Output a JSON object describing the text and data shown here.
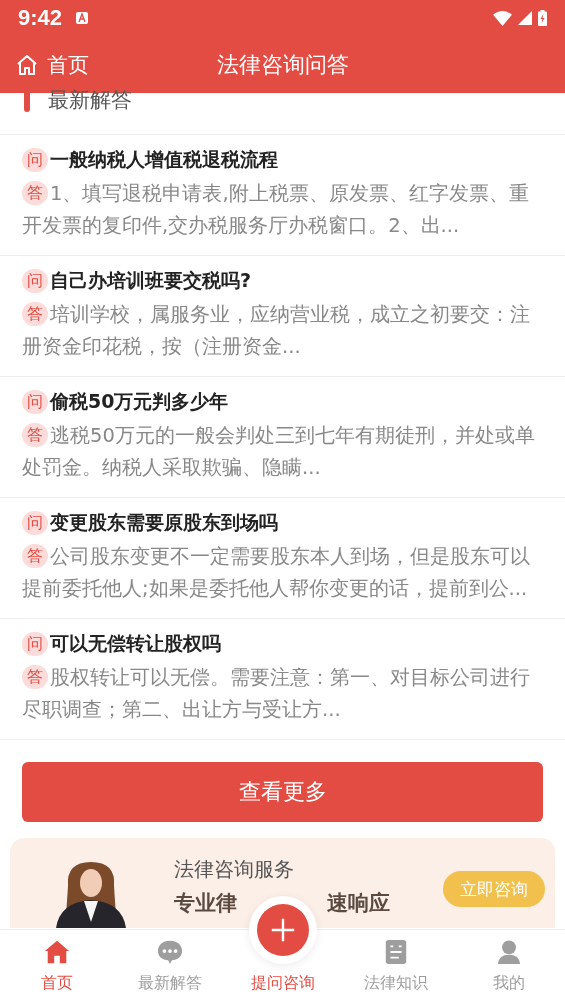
{
  "status_bar": {
    "time": "9:42"
  },
  "header": {
    "back_label": "首页",
    "title": "法律咨询问答"
  },
  "section": {
    "title": "最新解答"
  },
  "qa_list": [
    {
      "q_tag": "问",
      "question": "一般纳税人增值税退税流程",
      "a_tag": "答",
      "answer": "1、填写退税申请表,附上税票、原发票、红字发票、重开发票的复印件,交办税服务厅办税窗口。2、出..."
    },
    {
      "q_tag": "问",
      "question": "自己办培训班要交税吗?",
      "a_tag": "答",
      "answer": "培训学校，属服务业，应纳营业税，成立之初要交：注册资金印花税，按（注册资金..."
    },
    {
      "q_tag": "问",
      "question": "偷税50万元判多少年",
      "a_tag": "答",
      "answer": "逃税50万元的一般会判处三到七年有期徒刑，并处或单处罚金。纳税人采取欺骗、隐瞒..."
    },
    {
      "q_tag": "问",
      "question": "变更股东需要原股东到场吗",
      "a_tag": "答",
      "answer": "公司股东变更不一定需要股东本人到场，但是股东可以提前委托他人;如果是委托他人帮你变更的话，提前到公..."
    },
    {
      "q_tag": "问",
      "question": "可以无偿转让股权吗",
      "a_tag": "答",
      "answer": "股权转让可以无偿。需要注意：第一、对目标公司进行尽职调查；第二、出让方与受让方..."
    }
  ],
  "more_button": "查看更多",
  "banner": {
    "kind": "picture",
    "title": "法律咨询服务",
    "subtitle_parts": [
      "专业律",
      "速响应"
    ],
    "button": "立即咨询"
  },
  "tab_bar": [
    {
      "kind": "home",
      "label": "首页",
      "selected": true
    },
    {
      "kind": "chat",
      "label": "最新解答",
      "selected": false
    },
    {
      "kind": "fab",
      "label": "提问咨询",
      "selected": false
    },
    {
      "kind": "doc",
      "label": "法律知识",
      "selected": false
    },
    {
      "kind": "user",
      "label": "我的",
      "selected": false
    }
  ]
}
